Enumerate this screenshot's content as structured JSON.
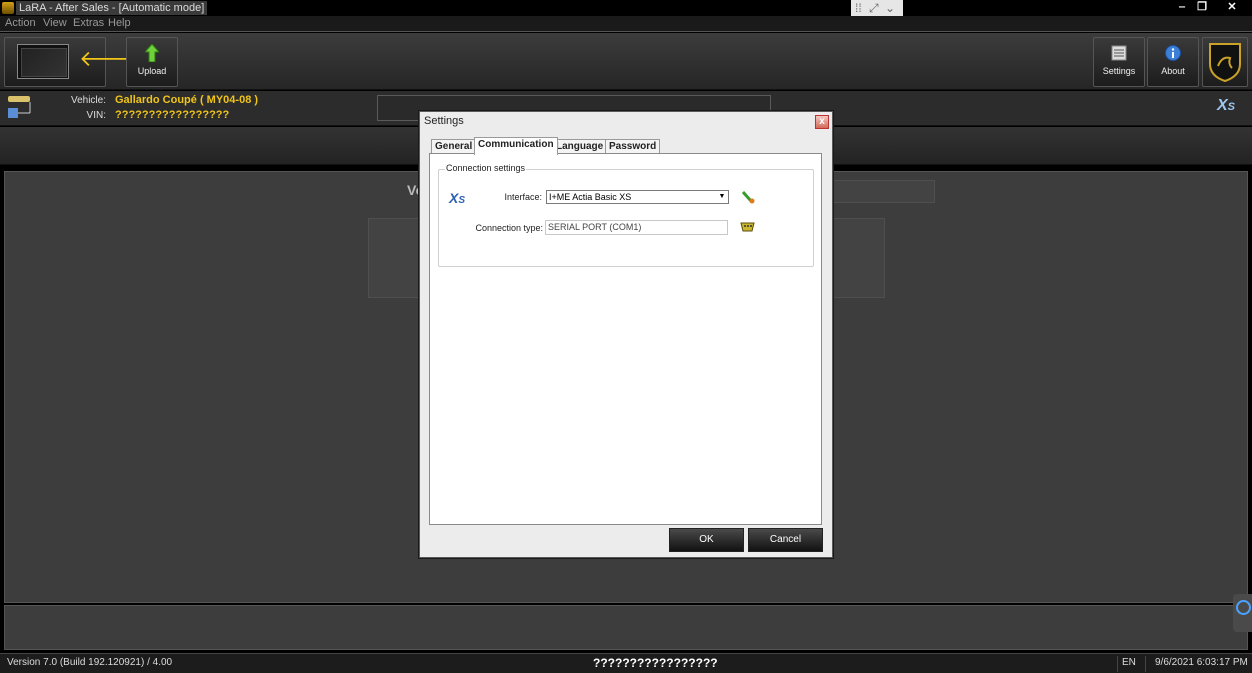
{
  "window": {
    "title": "LaRA - After Sales - [Automatic mode]",
    "minimize": "‒",
    "maximize": "❐",
    "close": "✕"
  },
  "teamviewer_bar": {
    "expand": "⤢",
    "collapse": "⌄"
  },
  "menu": [
    "Action",
    "View",
    "Extras",
    "Help"
  ],
  "toolbar": {
    "upload_label": "Upload",
    "settings_label": "Settings",
    "about_label": "About"
  },
  "vehicle": {
    "vehicle_label": "Vehicle:",
    "vehicle_value": "Gallardo Coupé ( MY04-08 )",
    "vin_label": "VIN:",
    "vin_value": "?????????????????"
  },
  "main": {
    "faded_heading": "Ve"
  },
  "dialog": {
    "title": "Settings",
    "close": "x",
    "tabs": [
      "General",
      "Communication",
      "Language",
      "Password"
    ],
    "active_tab": "Communication",
    "group_label": "Connection settings",
    "interface_label": "Interface:",
    "interface_value": "I+ME Actia Basic XS",
    "connection_type_label": "Connection type:",
    "connection_type_value": "SERIAL PORT (COM1)",
    "ok_label": "OK",
    "cancel_label": "Cancel"
  },
  "status": {
    "version": "Version 7.0 (Build 192.120921) / 4.00",
    "center": "?????????????????",
    "language": "EN",
    "datetime": "9/6/2021 6:03:17 PM"
  },
  "colors": {
    "accent_yellow": "#f0c419",
    "background": "#3d3d3d"
  }
}
